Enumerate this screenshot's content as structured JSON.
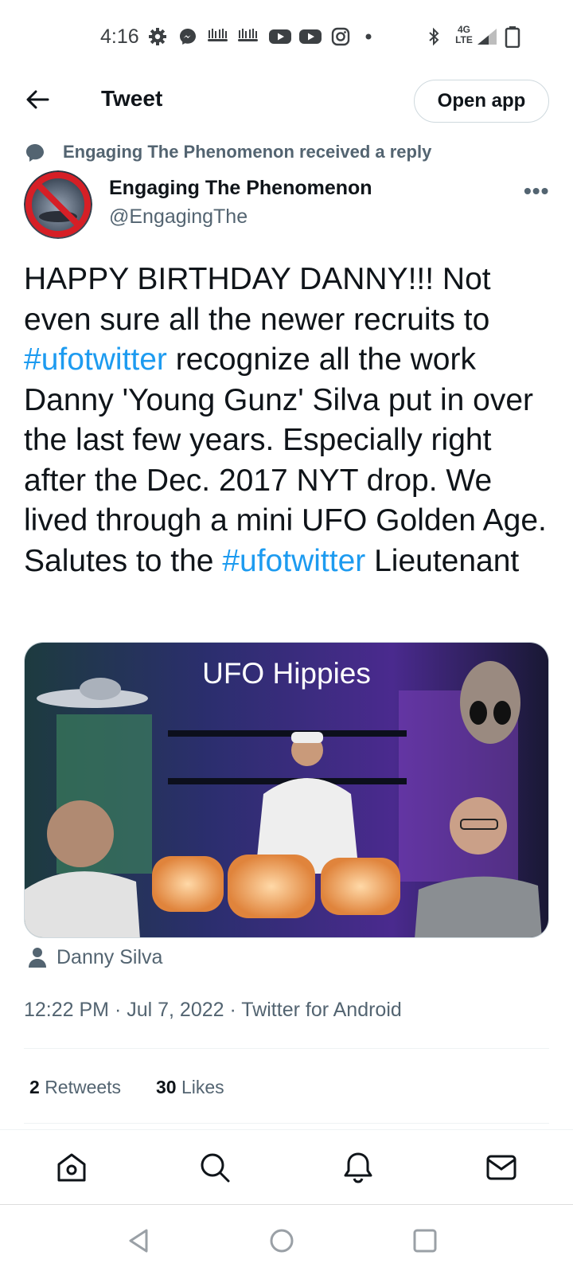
{
  "status_bar": {
    "time": "4:16",
    "network": "4G LTE",
    "icons": [
      "gear-icon",
      "messenger-icon",
      "kick-icon",
      "kick-icon",
      "youtube-icon",
      "youtube-icon",
      "instagram-icon",
      "dot-icon",
      "bluetooth-icon",
      "signal-icon",
      "battery-icon"
    ]
  },
  "header": {
    "title": "Tweet",
    "open_app_label": "Open app"
  },
  "context": {
    "text": "Engaging The Phenomenon received a reply"
  },
  "author": {
    "name": "Engaging The Phenomenon",
    "handle": "@EngagingThe",
    "avatar_text": "Engaging The Phenomenon",
    "more_label": "•••"
  },
  "tweet": {
    "p1": "HAPPY BIRTHDAY DANNY!!! Not even sure all the newer recruits to ",
    "tag1": "#ufotwitter",
    "p2": " recognize all the work Danny 'Young Gunz' Silva put in over the last few years. Especially right after the Dec. 2017 NYT drop. We lived through a mini UFO Golden Age. Salutes to the ",
    "tag2": "#ufotwitter",
    "p3": " Lieutenant"
  },
  "media": {
    "title": "UFO Hippies"
  },
  "tagged_user": "Danny Silva",
  "meta": "12:22 PM · Jul 7, 2022 · Twitter for Android",
  "stats": {
    "retweets_count": "2",
    "retweets_label": "Retweets",
    "likes_count": "30",
    "likes_label": "Likes"
  },
  "colors": {
    "link": "#1d9bf0",
    "secondary": "#536471",
    "text": "#0f1419"
  },
  "bottom_nav": [
    "home-icon",
    "search-icon",
    "notifications-icon",
    "messages-icon"
  ],
  "system_nav": [
    "back-icon",
    "home-circle-icon",
    "recents-icon"
  ]
}
